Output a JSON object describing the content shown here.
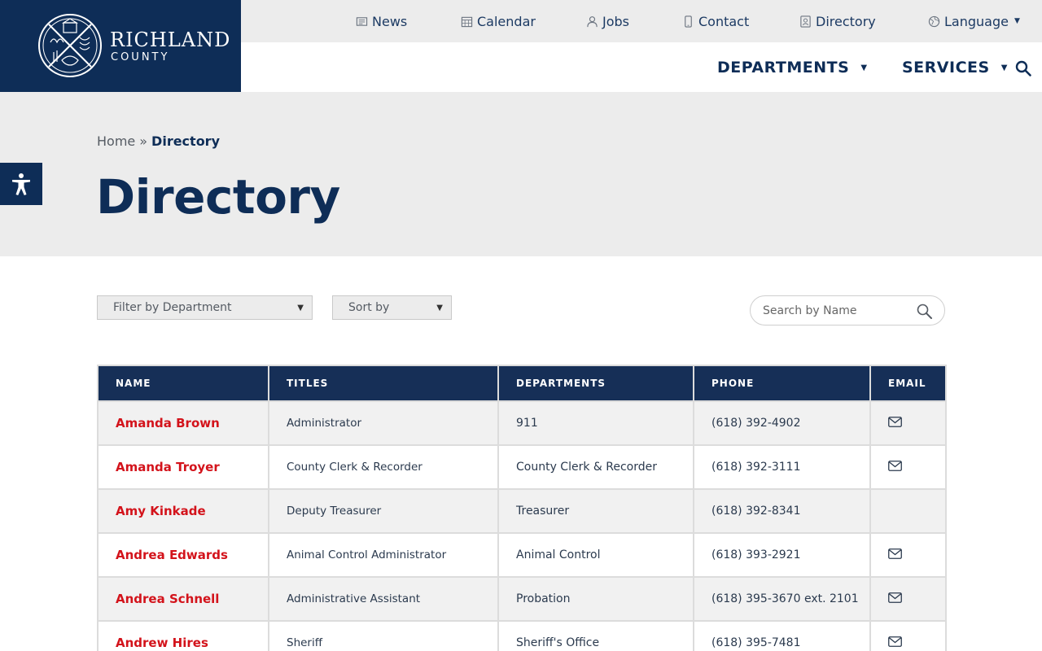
{
  "brand": {
    "name_line1": "RICHLAND",
    "name_line2": "COUNTY"
  },
  "utility_nav": [
    {
      "label": "News",
      "icon": "newspaper-icon"
    },
    {
      "label": "Calendar",
      "icon": "calendar-icon"
    },
    {
      "label": "Jobs",
      "icon": "person-icon"
    },
    {
      "label": "Contact",
      "icon": "phone-icon"
    },
    {
      "label": "Directory",
      "icon": "contact-card-icon"
    },
    {
      "label": "Language",
      "icon": "globe-icon"
    }
  ],
  "main_nav": [
    {
      "label": "DEPARTMENTS"
    },
    {
      "label": "SERVICES"
    }
  ],
  "breadcrumb": {
    "home": "Home",
    "separator": "»",
    "current": "Directory"
  },
  "page": {
    "title": "Directory"
  },
  "filters": {
    "department": "Filter by Department",
    "sort": "Sort by",
    "search_placeholder": "Search by Name"
  },
  "table": {
    "headers": [
      "NAME",
      "TITLES",
      "DEPARTMENTS",
      "PHONE",
      "EMAIL"
    ],
    "rows": [
      {
        "name": "Amanda Brown",
        "title": "Administrator",
        "department": "911",
        "phone": "(618) 392-4902",
        "email": true
      },
      {
        "name": "Amanda Troyer",
        "title": "County Clerk & Recorder",
        "department": "County Clerk & Recorder",
        "phone": "(618) 392-3111",
        "email": true
      },
      {
        "name": "Amy Kinkade",
        "title": "Deputy Treasurer",
        "department": "Treasurer",
        "phone": "(618) 392-8341",
        "email": false
      },
      {
        "name": "Andrea Edwards",
        "title": "Animal Control Administrator",
        "department": "Animal Control",
        "phone": "(618) 393-2921",
        "email": true
      },
      {
        "name": "Andrea Schnell",
        "title": "Administrative Assistant",
        "department": "Probation",
        "phone": "(618) 395-3670 ext. 2101",
        "email": true
      },
      {
        "name": "Andrew Hires",
        "title": "Sheriff",
        "department": "Sheriff's Office",
        "phone": "(618) 395-7481",
        "email": true
      }
    ]
  },
  "colors": {
    "navy": "#0e2d57",
    "header_navy": "#162f57",
    "name_red": "#d3131b",
    "hero_gray": "#ececec"
  }
}
